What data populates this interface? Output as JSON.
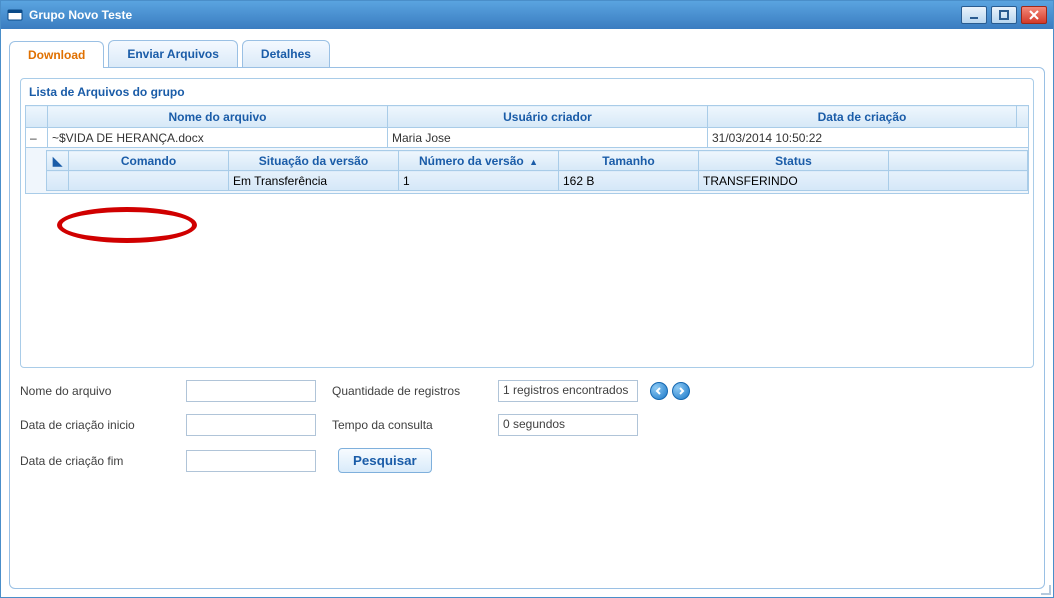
{
  "window": {
    "title": "Grupo Novo Teste"
  },
  "tabs": {
    "download": "Download",
    "enviar": "Enviar Arquivos",
    "detalhes": "Detalhes"
  },
  "group": {
    "title": "Lista de Arquivos do grupo",
    "headers": {
      "nome": "Nome do arquivo",
      "usuario": "Usuário criador",
      "data": "Data de criação"
    },
    "row": {
      "nome": "~$VIDA DE HERANÇA.docx",
      "usuario": "Maria Jose",
      "data": "31/03/2014 10:50:22"
    },
    "inner_headers": {
      "comando": "Comando",
      "situacao": "Situação da versão",
      "numero": "Número da versão",
      "tamanho": "Tamanho",
      "status": "Status"
    },
    "inner_row": {
      "comando": "",
      "situacao": "Em Transferência",
      "numero": "1",
      "tamanho": "162 B",
      "status": "TRANSFERINDO"
    }
  },
  "search": {
    "nome_label": "Nome do arquivo",
    "qtd_label": "Quantidade de registros",
    "qtd_value": "1 registros encontrados",
    "data_ini_label": "Data de criação inicio",
    "tempo_label": "Tempo da consulta",
    "tempo_value": "0 segundos",
    "data_fim_label": "Data de criação fim",
    "pesquisar": "Pesquisar"
  },
  "sort_arrow": "▲"
}
